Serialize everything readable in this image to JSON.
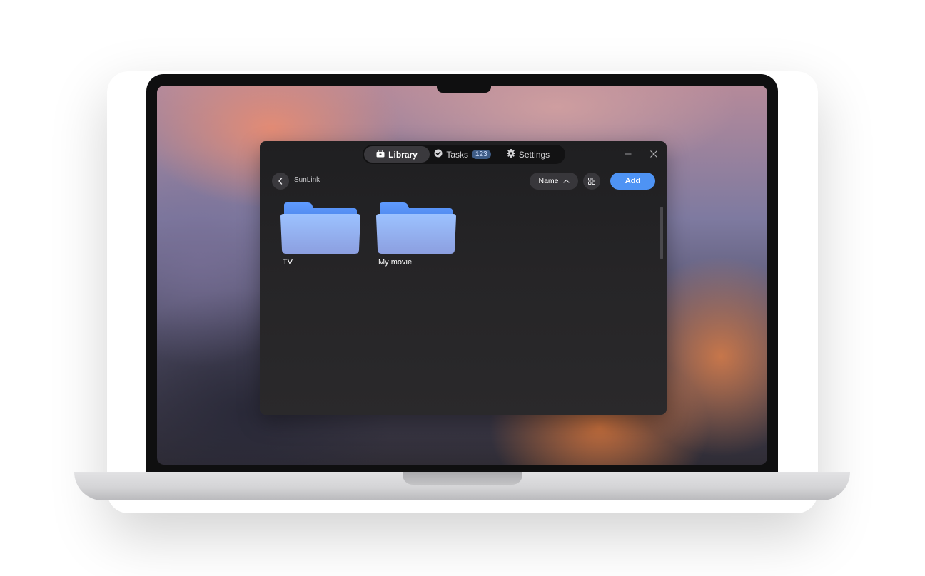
{
  "tabs": {
    "library": "Library",
    "tasks": "Tasks",
    "tasks_count": "123",
    "settings": "Settings",
    "active": "Library"
  },
  "toolbar": {
    "breadcrumb": "SunLink",
    "sort_label": "Name",
    "add_label": "Add"
  },
  "folders": [
    {
      "name": "TV",
      "icon": "folder-icon"
    },
    {
      "name": "My movie",
      "icon": "folder-icon"
    }
  ],
  "colors": {
    "accent": "#4e93f4",
    "folder": "#8fb8ff",
    "window_bg": "#242325"
  }
}
